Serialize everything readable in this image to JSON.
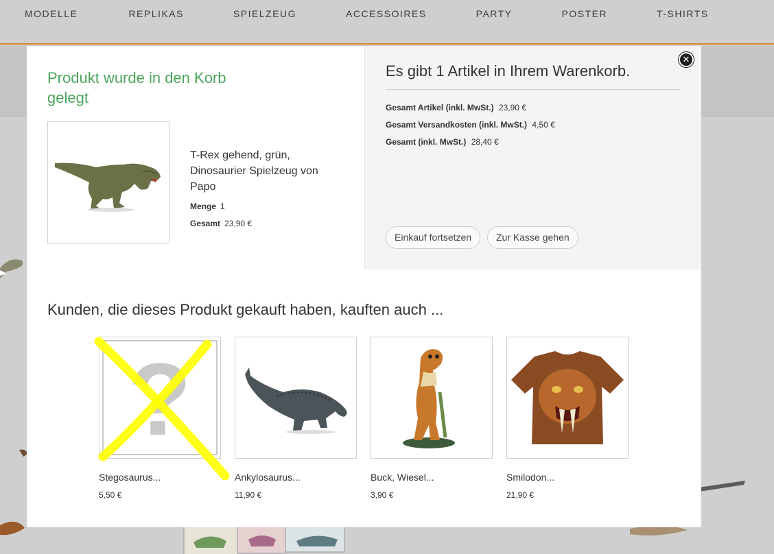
{
  "nav": {
    "items": [
      "MODELLE",
      "REPLIKAS",
      "SPIELZEUG",
      "ACCESSOIRES",
      "PARTY",
      "POSTER",
      "T-SHIRTS"
    ]
  },
  "modal": {
    "added_title": "Produkt wurde in den Korb gelegt",
    "product": {
      "name": "T-Rex gehend, grün, Dinosaurier Spielzeug von Papo",
      "qty_label": "Menge",
      "qty_value": "1",
      "total_label": "Gesamt",
      "total_value": "23,90 €"
    },
    "cart": {
      "title": "Es gibt 1 Artikel in Ihrem Warenkorb.",
      "items_label": "Gesamt Artikel (inkl. MwSt.)",
      "items_value": "23,90 €",
      "shipping_label": "Gesamt Versandkosten (inkl. MwSt.)",
      "shipping_value": "4,50 €",
      "total_label": "Gesamt (inkl. MwSt.)",
      "total_value": "28,40 €",
      "continue_label": "Einkauf fortsetzen",
      "checkout_label": "Zur Kasse gehen"
    },
    "close_icon": "close-icon"
  },
  "reco": {
    "title": "Kunden, die dieses Produkt gekauft haben, kauften auch ...",
    "items": [
      {
        "name": "Stegosaurus...",
        "price": "5,50 €",
        "image": "placeholder-question-mark"
      },
      {
        "name": "Ankylosaurus...",
        "price": "11,90 €",
        "image": "ankylosaurus-figure"
      },
      {
        "name": "Buck, Wiesel...",
        "price": "3,90 €",
        "image": "weasel-figure"
      },
      {
        "name": "Smilodon...",
        "price": "21,90 €",
        "image": "smilodon-tshirt"
      }
    ]
  },
  "colors": {
    "accent_orange": "#d98a24",
    "success_green": "#4ba55b",
    "annotation_yellow": "#ffff00"
  }
}
